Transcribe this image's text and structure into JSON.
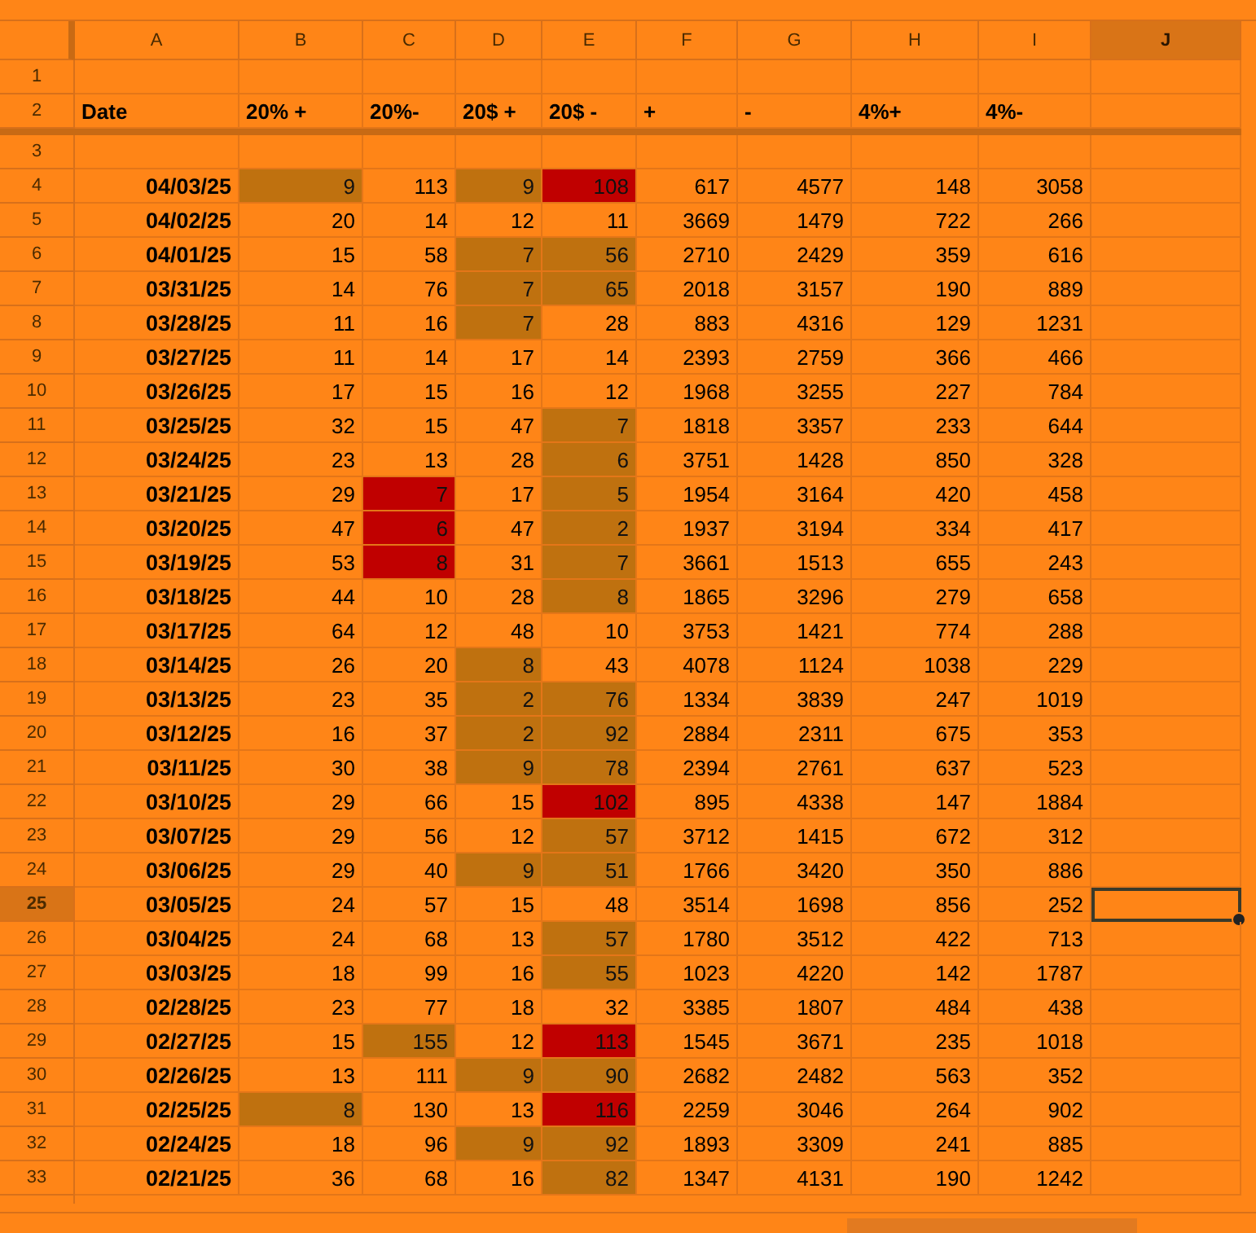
{
  "columns": [
    {
      "letter": "A",
      "selected": false
    },
    {
      "letter": "B",
      "selected": false
    },
    {
      "letter": "C",
      "selected": false
    },
    {
      "letter": "D",
      "selected": false
    },
    {
      "letter": "E",
      "selected": false
    },
    {
      "letter": "F",
      "selected": false
    },
    {
      "letter": "G",
      "selected": false
    },
    {
      "letter": "H",
      "selected": false
    },
    {
      "letter": "I",
      "selected": false
    },
    {
      "letter": "J",
      "selected": true
    }
  ],
  "rows": [
    {
      "number": "1",
      "kind": "blank",
      "selected": false
    },
    {
      "number": "2",
      "kind": "header",
      "selected": false,
      "labels": [
        "Date",
        "20% +",
        "20%-",
        "20$ +",
        "20$ -",
        "+",
        "-",
        "4%+",
        "4%-"
      ]
    },
    {
      "number": "3",
      "kind": "blank",
      "selected": false
    },
    {
      "number": "4",
      "kind": "data",
      "selected": false,
      "date": "04/03/25",
      "values": [
        {
          "v": "9",
          "color": "#bf710f"
        },
        "113",
        {
          "v": "9",
          "color": "#bf710f"
        },
        {
          "v": "108",
          "color": "#c00000"
        },
        "617",
        "4577",
        "148",
        "3058"
      ]
    },
    {
      "number": "5",
      "kind": "data",
      "selected": false,
      "date": "04/02/25",
      "values": [
        "20",
        "14",
        "12",
        "11",
        "3669",
        "1479",
        "722",
        "266"
      ]
    },
    {
      "number": "6",
      "kind": "data",
      "selected": false,
      "date": "04/01/25",
      "values": [
        "15",
        "58",
        {
          "v": "7",
          "color": "#bf710f"
        },
        {
          "v": "56",
          "color": "#bf710f"
        },
        "2710",
        "2429",
        "359",
        "616"
      ]
    },
    {
      "number": "7",
      "kind": "data",
      "selected": false,
      "date": "03/31/25",
      "values": [
        "14",
        "76",
        {
          "v": "7",
          "color": "#bf710f"
        },
        {
          "v": "65",
          "color": "#bf710f"
        },
        "2018",
        "3157",
        "190",
        "889"
      ]
    },
    {
      "number": "8",
      "kind": "data",
      "selected": false,
      "date": "03/28/25",
      "values": [
        "11",
        "16",
        {
          "v": "7",
          "color": "#bf710f"
        },
        "28",
        "883",
        "4316",
        "129",
        "1231"
      ]
    },
    {
      "number": "9",
      "kind": "data",
      "selected": false,
      "date": "03/27/25",
      "values": [
        "11",
        "14",
        "17",
        "14",
        "2393",
        "2759",
        "366",
        "466"
      ]
    },
    {
      "number": "10",
      "kind": "data",
      "selected": false,
      "date": "03/26/25",
      "values": [
        "17",
        "15",
        "16",
        "12",
        "1968",
        "3255",
        "227",
        "784"
      ]
    },
    {
      "number": "11",
      "kind": "data",
      "selected": false,
      "date": "03/25/25",
      "values": [
        "32",
        "15",
        "47",
        {
          "v": "7",
          "color": "#bf710f"
        },
        "1818",
        "3357",
        "233",
        "644"
      ]
    },
    {
      "number": "12",
      "kind": "data",
      "selected": false,
      "date": "03/24/25",
      "values": [
        "23",
        "13",
        "28",
        {
          "v": "6",
          "color": "#bf710f"
        },
        "3751",
        "1428",
        "850",
        "328"
      ]
    },
    {
      "number": "13",
      "kind": "data",
      "selected": false,
      "date": "03/21/25",
      "values": [
        "29",
        {
          "v": "7",
          "color": "#c00000"
        },
        "17",
        {
          "v": "5",
          "color": "#bf710f"
        },
        "1954",
        "3164",
        "420",
        "458"
      ]
    },
    {
      "number": "14",
      "kind": "data",
      "selected": false,
      "date": "03/20/25",
      "values": [
        "47",
        {
          "v": "6",
          "color": "#c00000"
        },
        "47",
        {
          "v": "2",
          "color": "#bf710f"
        },
        "1937",
        "3194",
        "334",
        "417"
      ]
    },
    {
      "number": "15",
      "kind": "data",
      "selected": false,
      "date": "03/19/25",
      "values": [
        "53",
        {
          "v": "8",
          "color": "#c00000"
        },
        "31",
        {
          "v": "7",
          "color": "#bf710f"
        },
        "3661",
        "1513",
        "655",
        "243"
      ]
    },
    {
      "number": "16",
      "kind": "data",
      "selected": false,
      "date": "03/18/25",
      "values": [
        "44",
        "10",
        "28",
        {
          "v": "8",
          "color": "#bf710f"
        },
        "1865",
        "3296",
        "279",
        "658"
      ]
    },
    {
      "number": "17",
      "kind": "data",
      "selected": false,
      "date": "03/17/25",
      "values": [
        "64",
        "12",
        "48",
        "10",
        "3753",
        "1421",
        "774",
        "288"
      ]
    },
    {
      "number": "18",
      "kind": "data",
      "selected": false,
      "date": "03/14/25",
      "values": [
        "26",
        "20",
        {
          "v": "8",
          "color": "#bf710f"
        },
        "43",
        "4078",
        "1124",
        "1038",
        "229"
      ]
    },
    {
      "number": "19",
      "kind": "data",
      "selected": false,
      "date": "03/13/25",
      "values": [
        "23",
        "35",
        {
          "v": "2",
          "color": "#bf710f"
        },
        {
          "v": "76",
          "color": "#bf710f"
        },
        "1334",
        "3839",
        "247",
        "1019"
      ]
    },
    {
      "number": "20",
      "kind": "data",
      "selected": false,
      "date": "03/12/25",
      "values": [
        "16",
        "37",
        {
          "v": "2",
          "color": "#bf710f"
        },
        {
          "v": "92",
          "color": "#bf710f"
        },
        "2884",
        "2311",
        "675",
        "353"
      ]
    },
    {
      "number": "21",
      "kind": "data",
      "selected": false,
      "date": "03/11/25",
      "values": [
        "30",
        "38",
        {
          "v": "9",
          "color": "#bf710f"
        },
        {
          "v": "78",
          "color": "#bf710f"
        },
        "2394",
        "2761",
        "637",
        "523"
      ]
    },
    {
      "number": "22",
      "kind": "data",
      "selected": false,
      "date": "03/10/25",
      "values": [
        "29",
        "66",
        "15",
        {
          "v": "102",
          "color": "#c00000"
        },
        "895",
        "4338",
        "147",
        "1884"
      ]
    },
    {
      "number": "23",
      "kind": "data",
      "selected": false,
      "date": "03/07/25",
      "values": [
        "29",
        "56",
        "12",
        {
          "v": "57",
          "color": "#bf710f"
        },
        "3712",
        "1415",
        "672",
        "312"
      ]
    },
    {
      "number": "24",
      "kind": "data",
      "selected": false,
      "date": "03/06/25",
      "values": [
        "29",
        "40",
        {
          "v": "9",
          "color": "#bf710f"
        },
        {
          "v": "51",
          "color": "#bf710f"
        },
        "1766",
        "3420",
        "350",
        "886"
      ]
    },
    {
      "number": "25",
      "kind": "data",
      "selected": true,
      "date": "03/05/25",
      "values": [
        "24",
        "57",
        "15",
        "48",
        "3514",
        "1698",
        "856",
        "252"
      ]
    },
    {
      "number": "26",
      "kind": "data",
      "selected": false,
      "date": "03/04/25",
      "values": [
        "24",
        "68",
        "13",
        {
          "v": "57",
          "color": "#bf710f"
        },
        "1780",
        "3512",
        "422",
        "713"
      ]
    },
    {
      "number": "27",
      "kind": "data",
      "selected": false,
      "date": "03/03/25",
      "values": [
        "18",
        "99",
        "16",
        {
          "v": "55",
          "color": "#bf710f"
        },
        "1023",
        "4220",
        "142",
        "1787"
      ]
    },
    {
      "number": "28",
      "kind": "data",
      "selected": false,
      "date": "02/28/25",
      "values": [
        "23",
        "77",
        "18",
        "32",
        "3385",
        "1807",
        "484",
        "438"
      ]
    },
    {
      "number": "29",
      "kind": "data",
      "selected": false,
      "date": "02/27/25",
      "values": [
        "15",
        {
          "v": "155",
          "color": "#bf710f"
        },
        "12",
        {
          "v": "113",
          "color": "#c00000"
        },
        "1545",
        "3671",
        "235",
        "1018"
      ]
    },
    {
      "number": "30",
      "kind": "data",
      "selected": false,
      "date": "02/26/25",
      "values": [
        "13",
        "111",
        {
          "v": "9",
          "color": "#bf710f"
        },
        {
          "v": "90",
          "color": "#bf710f"
        },
        "2682",
        "2482",
        "563",
        "352"
      ]
    },
    {
      "number": "31",
      "kind": "data",
      "selected": false,
      "date": "02/25/25",
      "values": [
        {
          "v": "8",
          "color": "#bf710f"
        },
        "130",
        "13",
        {
          "v": "116",
          "color": "#c00000"
        },
        "2259",
        "3046",
        "264",
        "902"
      ]
    },
    {
      "number": "32",
      "kind": "data",
      "selected": false,
      "date": "02/24/25",
      "values": [
        "18",
        "96",
        {
          "v": "9",
          "color": "#bf710f"
        },
        {
          "v": "92",
          "color": "#bf710f"
        },
        "1893",
        "3309",
        "241",
        "885"
      ]
    },
    {
      "number": "33",
      "kind": "data",
      "selected": false,
      "date": "02/21/25",
      "values": [
        "36",
        "68",
        "16",
        {
          "v": "82",
          "color": "#bf710f"
        },
        "1347",
        "4131",
        "190",
        "1242"
      ]
    }
  ]
}
